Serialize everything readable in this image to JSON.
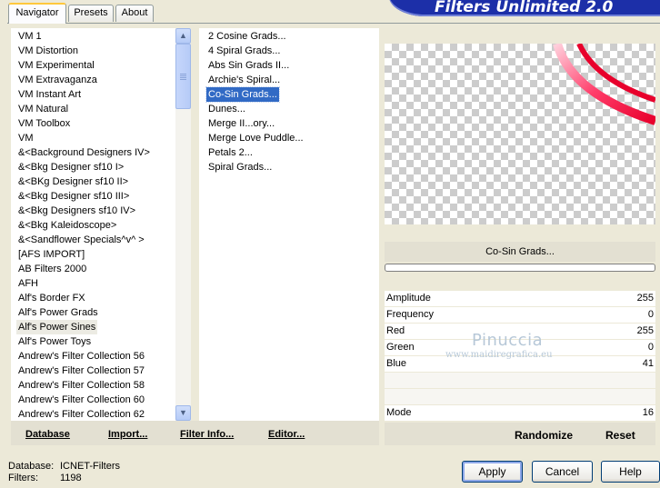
{
  "window": {
    "title": "Filters Unlimited 2.0"
  },
  "tabs": [
    {
      "label": "Navigator",
      "active": true
    },
    {
      "label": "Presets",
      "active": false
    },
    {
      "label": "About",
      "active": false
    }
  ],
  "categories": [
    "VM 1",
    "VM Distortion",
    "VM Experimental",
    "VM Extravaganza",
    "VM Instant Art",
    "VM Natural",
    "VM Toolbox",
    "VM",
    "&<Background Designers IV>",
    "&<Bkg Designer sf10 I>",
    "&<BKg Designer sf10 II>",
    "&<Bkg Designer sf10 III>",
    "&<Bkg Designers sf10 IV>",
    "&<Bkg Kaleidoscope>",
    "&<Sandflower Specials^v^ >",
    "[AFS IMPORT]",
    "AB Filters 2000",
    "AFH",
    "Alf's Border FX",
    "Alf's Power Grads",
    "Alf's Power Sines",
    "Alf's Power Toys",
    "Andrew's Filter Collection 56",
    "Andrew's Filter Collection 57",
    "Andrew's Filter Collection 58",
    "Andrew's Filter Collection 60",
    "Andrew's Filter Collection 62"
  ],
  "selected_category": "Alf's Power Sines",
  "filters": [
    "2 Cosine Grads...",
    "4 Spiral Grads...",
    "Abs Sin Grads II...",
    "Archie's Spiral...",
    "Co-Sin Grads...",
    "Dunes...",
    "Merge II...ory...",
    "Merge Love Puddle...",
    "Petals 2...",
    "Spiral Grads..."
  ],
  "selected_filter": "Co-Sin Grads...",
  "list_buttons": {
    "database": "Database",
    "import": "Import...",
    "filter_info": "Filter Info...",
    "editor": "Editor..."
  },
  "preview": {
    "filter_name": "Co-Sin Grads...",
    "progress_fraction": 0
  },
  "params": [
    {
      "label": "Amplitude",
      "value": "255"
    },
    {
      "label": "Frequency",
      "value": "0"
    },
    {
      "label": "Red",
      "value": "255"
    },
    {
      "label": "Green",
      "value": "0"
    },
    {
      "label": "Blue",
      "value": "41"
    }
  ],
  "mode": {
    "label": "Mode",
    "value": "16"
  },
  "actions": {
    "randomize": "Randomize",
    "reset": "Reset"
  },
  "footer": {
    "database_label": "Database:",
    "database_value": "ICNET-Filters",
    "filters_label": "Filters:",
    "filters_value": "1198"
  },
  "buttons": {
    "apply": "Apply",
    "cancel": "Cancel",
    "help": "Help"
  },
  "watermark": {
    "name": "Pinuccia",
    "site": "www.maidiregrafica.eu"
  },
  "colors": {
    "selection": "#316ac5",
    "banner": "#1c2fa8",
    "gradient_red": "#e8002c"
  },
  "icons": {
    "scroll_up": "chevron-up-icon",
    "scroll_down": "chevron-down-icon"
  }
}
